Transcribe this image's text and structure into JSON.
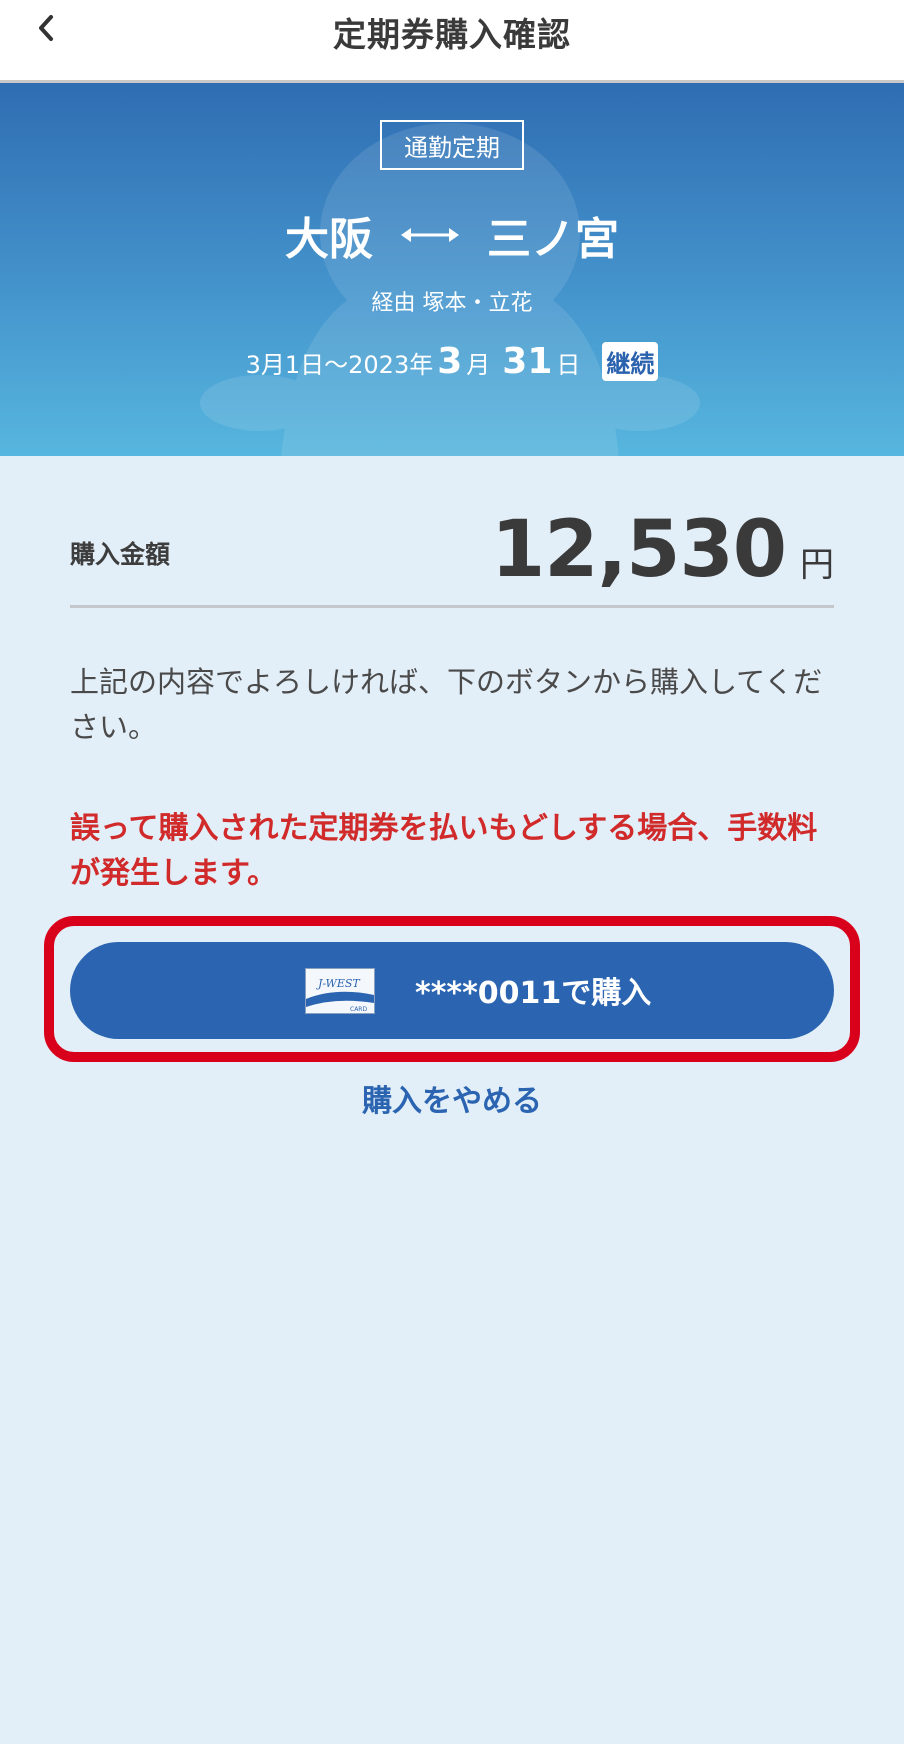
{
  "header": {
    "title": "定期券購入確認",
    "back_icon": "chevron-left-icon"
  },
  "pass": {
    "type": "通勤定期",
    "from": "大阪",
    "to": "三ノ宮",
    "via": "経由 塚本・立花",
    "period_prefix": "3月1日〜2023年",
    "period_month": "3",
    "period_month_unit": "月",
    "period_day": "31",
    "period_day_unit": "日",
    "renew_badge": "継続"
  },
  "amount": {
    "label": "購入金額",
    "value": "12,530",
    "unit": "円"
  },
  "notice": "上記の内容でよろしければ、下のボタンから購入してください。",
  "warning": "誤って購入された定期券を払いもどしする場合、手数料が発生します。",
  "pay_button": {
    "label": "****0011で購入",
    "card_icon": "j-west-card-icon",
    "highlight_color": "#d9001b"
  },
  "cancel": {
    "label": "購入をやめる"
  },
  "colors": {
    "accent": "#2b64b1",
    "warning": "#d12a2a",
    "background": "#e3eff8"
  }
}
